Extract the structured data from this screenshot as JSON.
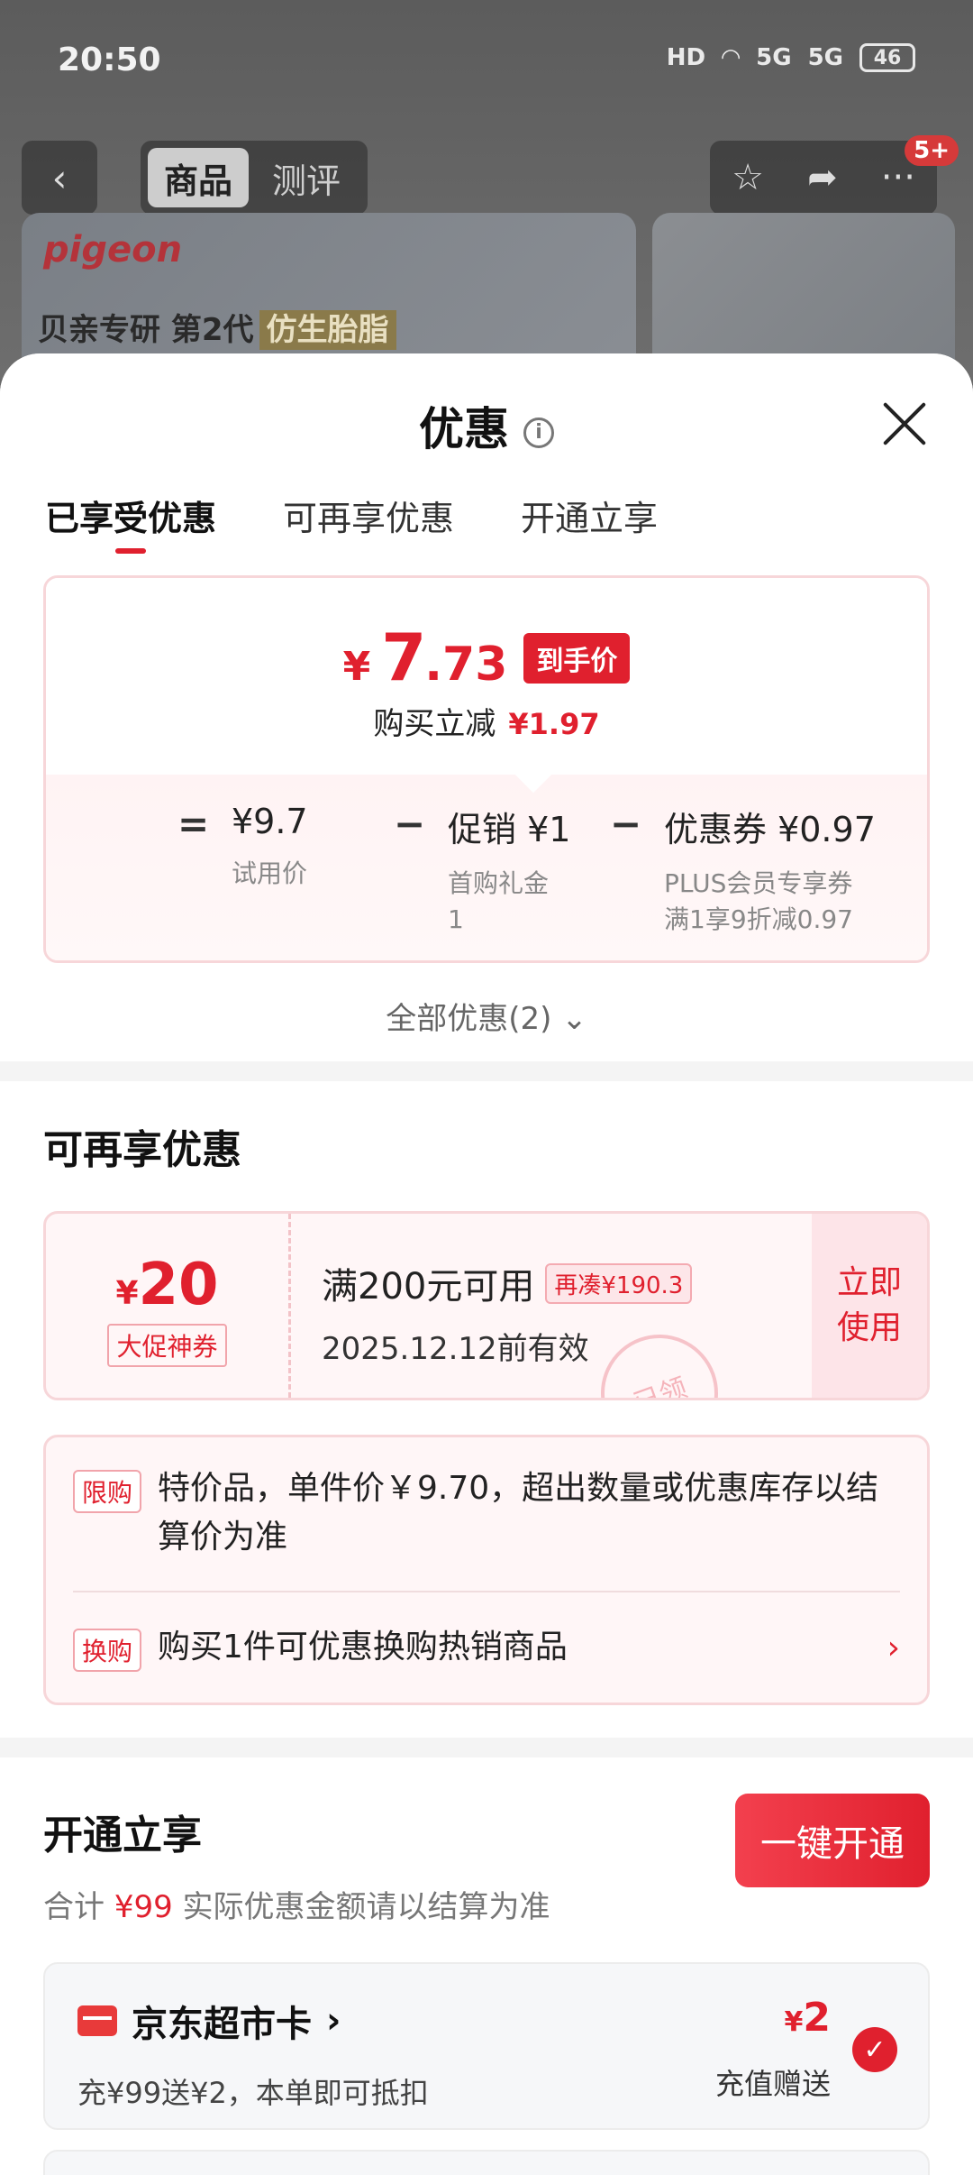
{
  "status": {
    "time": "20:50",
    "hd": "HD",
    "net1": "5G",
    "net2": "5G",
    "battery": "46"
  },
  "nav": {
    "tabs": [
      "商品",
      "测评"
    ],
    "badge": "5+"
  },
  "banner": {
    "brand": "pigeon",
    "text": "贝亲专研 第2代",
    "highlight": "仿生胎脂"
  },
  "sheet": {
    "title": "优惠",
    "tabs": [
      "已享受优惠",
      "可再享优惠",
      "开通立享"
    ]
  },
  "price": {
    "currency": "¥",
    "int": "7",
    "dec": ".73",
    "tag": "到手价",
    "reduce_label": "购买立减",
    "reduce_value": "¥1.97",
    "formula": {
      "eq": "=",
      "base_value": "¥9.7",
      "base_label": "试用价",
      "minus1": "−",
      "promo_value": "促销 ¥1",
      "promo_label": "首购礼金",
      "promo_label2": "1",
      "minus2": "−",
      "coupon_value": "优惠券 ¥0.97",
      "coupon_label": "PLUS会员专享券",
      "coupon_label2": "满1享9折减0.97"
    },
    "all_deals": "全部优惠(2)"
  },
  "more": {
    "title": "可再享优惠",
    "coupon": {
      "currency": "¥",
      "amount": "20",
      "type": "大促神券",
      "condition": "满200元可用",
      "tag": "再凑¥190.3",
      "expiry": "2025.12.12前有效",
      "action": "立即使用",
      "stamp": "已领"
    },
    "notice": {
      "tag1": "限购",
      "text1": "特价品，单件价￥9.70，超出数量或优惠库存以结算价为准",
      "tag2": "换购",
      "text2": "购买1件可优惠换购热销商品"
    }
  },
  "open": {
    "title": "开通立享",
    "sum_label": "合计",
    "sum_value": "¥99",
    "sum_note": "实际优惠金额请以结算为准",
    "button": "一键开通",
    "card": {
      "title": "京东超市卡",
      "desc": "充¥99送¥2，本单即可抵扣",
      "currency": "¥",
      "amount": "2",
      "note": "充值赠送"
    }
  },
  "colors": {
    "accent": "#e0202e",
    "light_pink": "#fff6f7"
  }
}
